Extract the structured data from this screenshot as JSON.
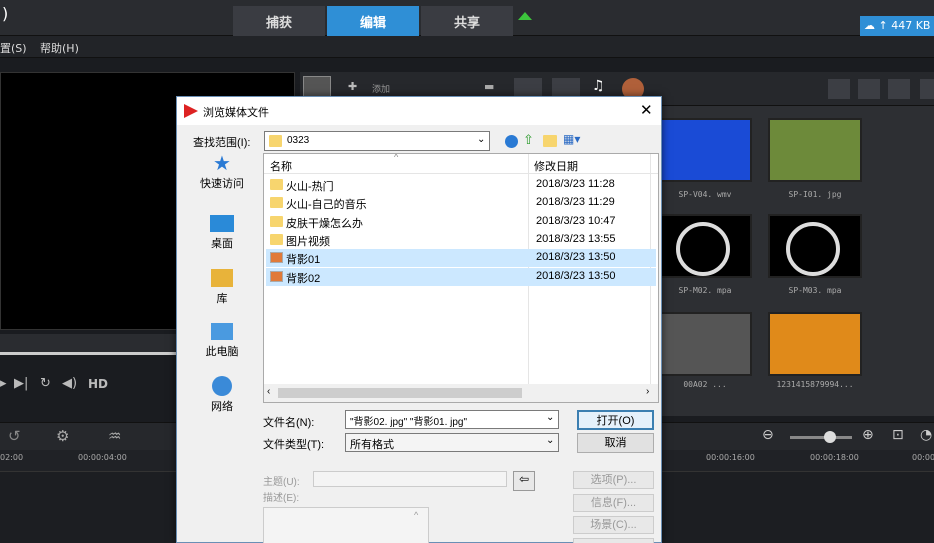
{
  "app": {
    "corner_glyph": ")"
  },
  "tabs": [
    "捕获",
    "编辑",
    "共享"
  ],
  "menu": {
    "settings_suffix": "置(S)",
    "help": "帮助(H)"
  },
  "cloud": {
    "label": "447 KB"
  },
  "library": {
    "add_label": "添加",
    "thumbs": [
      {
        "label": "SP-V04. wmv",
        "color": "#1a4bd6"
      },
      {
        "label": "SP-I01. jpg",
        "color": "#6d8a3a"
      },
      {
        "label": "SP-M02. mpa",
        "color": "#000"
      },
      {
        "label": "SP-M03. mpa",
        "color": "#000"
      },
      {
        "label": "00A02 ...",
        "color": "#555"
      },
      {
        "label": "1231415879994...",
        "color": "#e08a1a"
      }
    ]
  },
  "player": {
    "hd": "HD"
  },
  "ruler": {
    "ticks": [
      "02:00",
      "00:00:04:00",
      "00:00:16:00",
      "00:00:18:00",
      "00:00"
    ]
  },
  "dialog": {
    "title": "浏览媒体文件",
    "lookin_label": "查找范围(I):",
    "lookin_value": "0323",
    "places": [
      "快速访问",
      "桌面",
      "库",
      "此电脑",
      "网络"
    ],
    "col_name": "名称",
    "col_date": "修改日期",
    "files": [
      {
        "name": "火山-热门",
        "date": "2018/3/23 11:28",
        "type": "folder",
        "sel": false
      },
      {
        "name": "火山-自己的音乐",
        "date": "2018/3/23 11:29",
        "type": "folder",
        "sel": false
      },
      {
        "name": "皮肤干燥怎么办",
        "date": "2018/3/23 10:47",
        "type": "folder",
        "sel": false
      },
      {
        "name": "图片视频",
        "date": "2018/3/23 13:55",
        "type": "folder",
        "sel": false
      },
      {
        "name": "背影01",
        "date": "2018/3/23 13:50",
        "type": "image",
        "sel": true
      },
      {
        "name": "背影02",
        "date": "2018/3/23 13:50",
        "type": "image",
        "sel": true
      }
    ],
    "filename_label": "文件名(N):",
    "filename_value": "\"背影02. jpg\" \"背影01. jpg\"",
    "filetype_label": "文件类型(T):",
    "filetype_value": "所有格式",
    "open_btn": "打开(O)",
    "cancel_btn": "取消",
    "subject_label": "主题(U):",
    "desc_label": "描述(E):",
    "options_btn": "选项(P)...",
    "info_btn": "信息(F)...",
    "scene_btn": "场景(C)..."
  }
}
